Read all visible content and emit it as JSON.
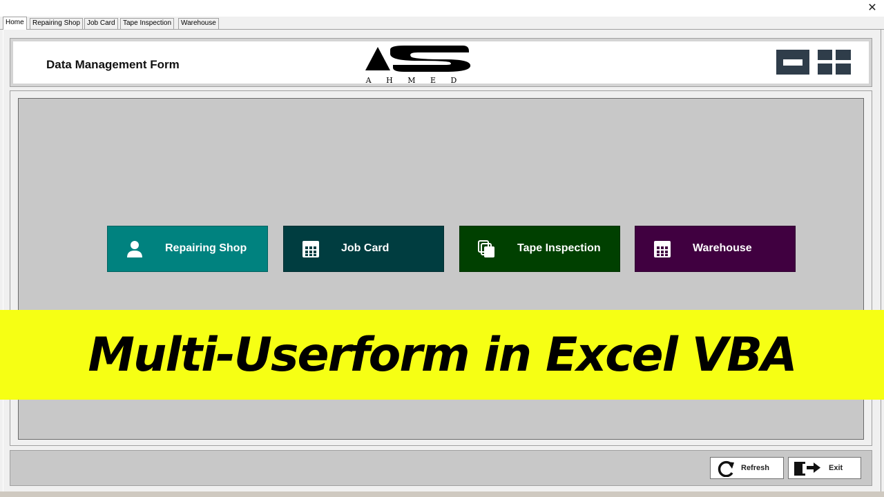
{
  "window": {
    "close_symbol": "✕"
  },
  "tabs": [
    {
      "label": "Home",
      "active": true
    },
    {
      "label": "Repairing Shop",
      "active": false
    },
    {
      "label": "Job Card",
      "active": false
    },
    {
      "label": "Tape Inspection",
      "active": false
    },
    {
      "label": "Warehouse",
      "active": false
    }
  ],
  "header": {
    "title": "Data Management Form",
    "logo_text": "AS",
    "logo_subtext": "A H M E D"
  },
  "nav_buttons": [
    {
      "label": "Repairing Shop",
      "icon": "user-icon",
      "color": "#00827f"
    },
    {
      "label": "Job Card",
      "icon": "grid-icon",
      "color": "#003d40"
    },
    {
      "label": "Tape Inspection",
      "icon": "copy-icon",
      "color": "#004000"
    },
    {
      "label": "Warehouse",
      "icon": "grid-icon",
      "color": "#400040"
    }
  ],
  "banner": {
    "text": "Multi-Userform in Excel VBA",
    "color": "#f6ff14"
  },
  "footer": {
    "refresh_label": "Refresh",
    "exit_label": "Exit"
  }
}
